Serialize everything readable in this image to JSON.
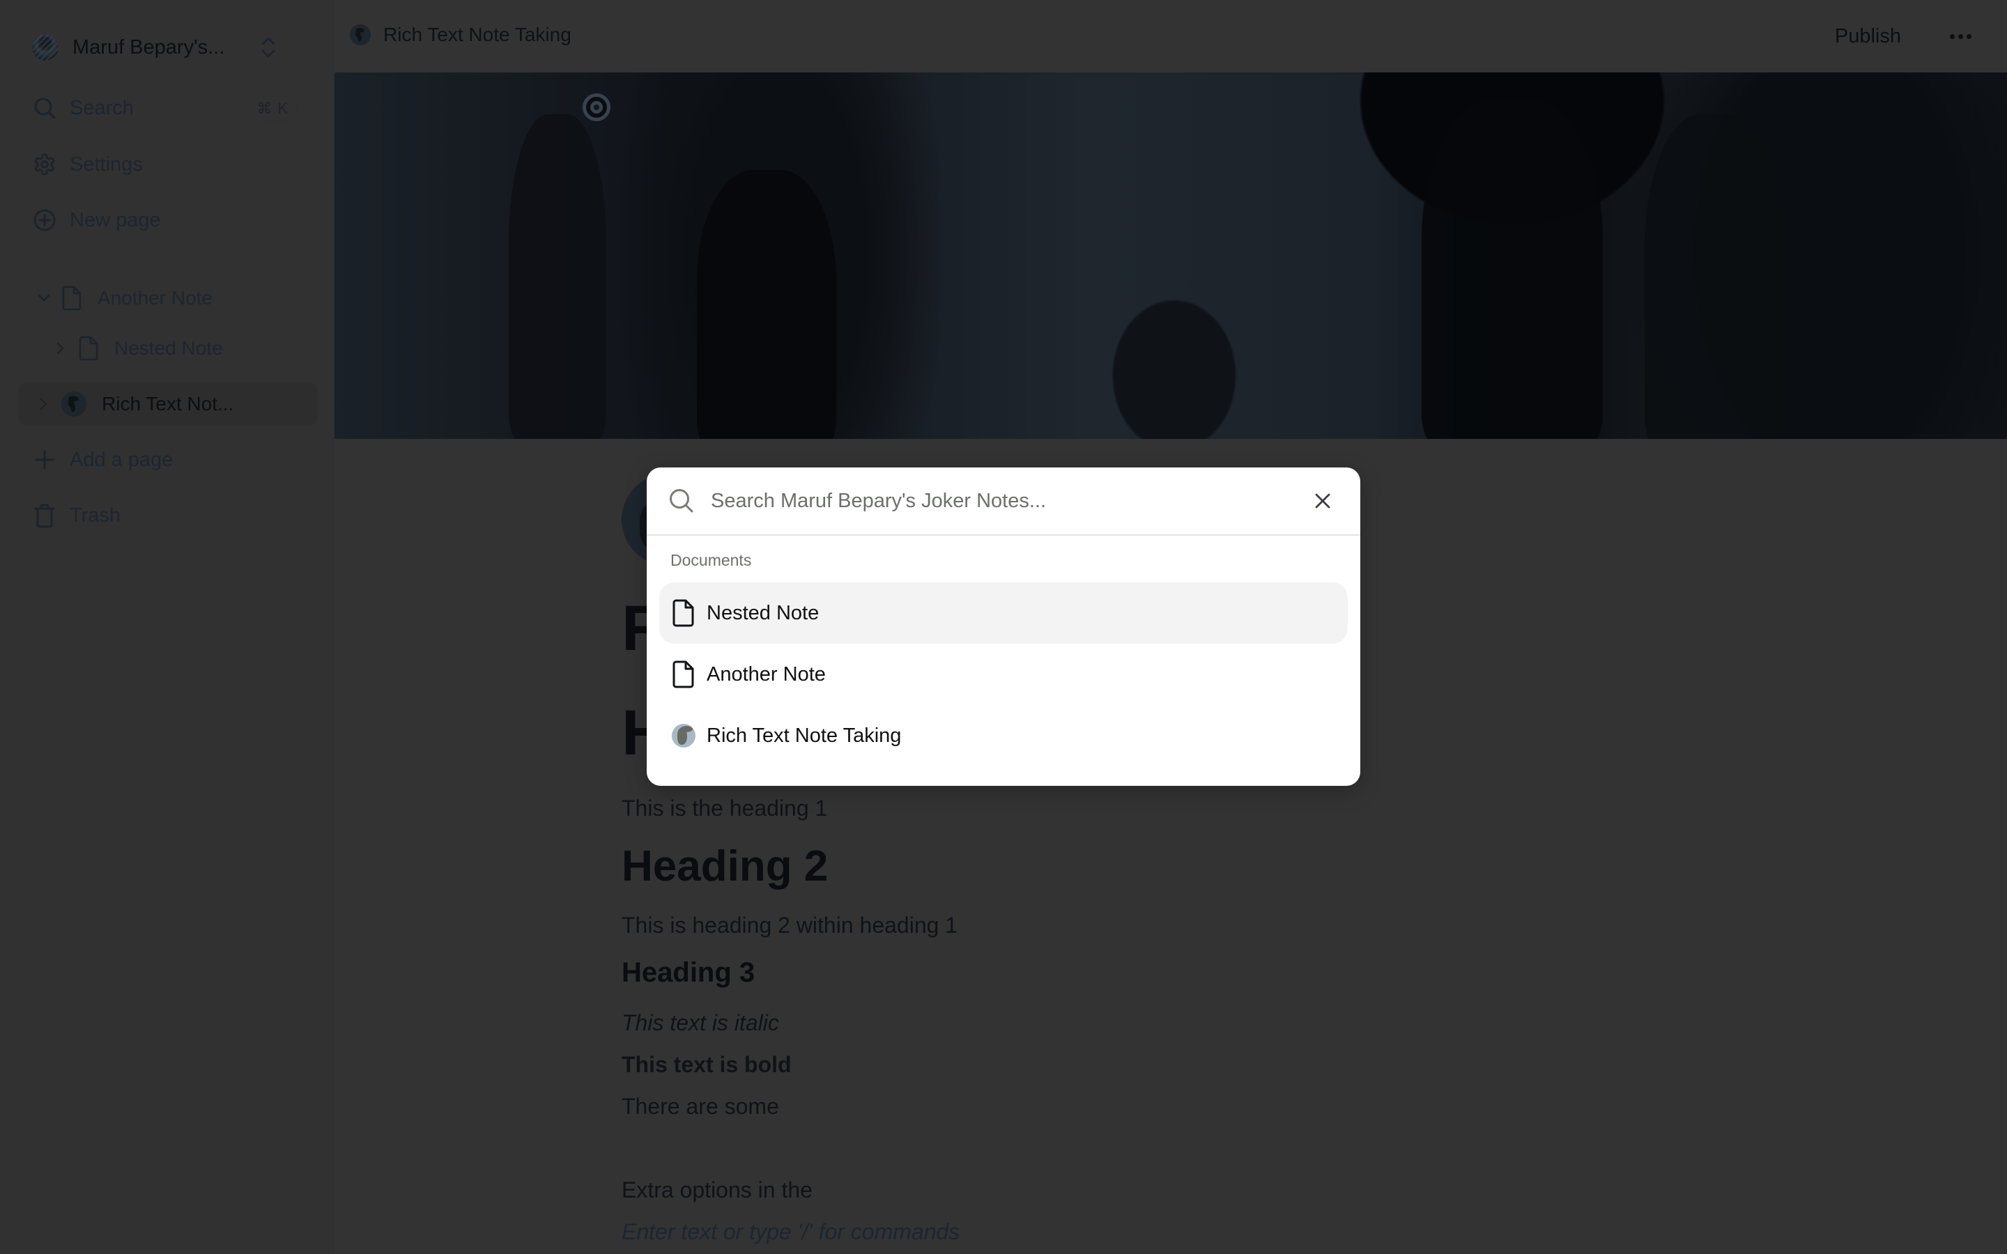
{
  "sidebar": {
    "workspace_name": "Maruf Bepary's...",
    "nav": [
      {
        "label": "Search",
        "icon": "search-icon",
        "shortcut": [
          "⌘",
          "K"
        ]
      },
      {
        "label": "Settings",
        "icon": "gear-icon"
      },
      {
        "label": "New page",
        "icon": "plus-circle-icon"
      }
    ],
    "tree": [
      {
        "label": "Another Note",
        "icon": "file-icon",
        "expanded": true,
        "depth": 0
      },
      {
        "label": "Nested Note",
        "icon": "file-icon",
        "expanded": false,
        "depth": 1
      },
      {
        "label": "Rich Text Not...",
        "icon": "globe-icon",
        "expanded": false,
        "depth": 0,
        "active": true
      }
    ],
    "footer": [
      {
        "label": "Add a page",
        "icon": "plus-icon"
      },
      {
        "label": "Trash",
        "icon": "trash-icon"
      }
    ]
  },
  "header": {
    "breadcrumb": "Rich Text Note Taking",
    "publish_label": "Publish",
    "more_label": "More options"
  },
  "document": {
    "title_partial": "R",
    "h1_partial": "H",
    "blocks": [
      {
        "type": "paragraph",
        "text": "This is the heading 1"
      },
      {
        "type": "heading2",
        "text": "Heading 2"
      },
      {
        "type": "paragraph",
        "text": "This is heading 2 within heading 1"
      },
      {
        "type": "heading3",
        "text": "Heading 3"
      },
      {
        "type": "italic",
        "text": "This text is italic"
      },
      {
        "type": "bold",
        "text": "This text is bold"
      },
      {
        "type": "paragraph",
        "text": "There are some"
      },
      {
        "type": "paragraph",
        "text": "Extra options in the"
      },
      {
        "type": "placeholder",
        "text": "Enter text or type '/' for commands"
      }
    ]
  },
  "search_modal": {
    "placeholder": "Search Maruf Bepary's Joker Notes...",
    "value": "",
    "section_label": "Documents",
    "results": [
      {
        "label": "Nested Note",
        "icon": "file-icon",
        "selected": true
      },
      {
        "label": "Another Note",
        "icon": "file-icon",
        "selected": false
      },
      {
        "label": "Rich Text Note Taking",
        "icon": "globe-icon",
        "selected": false
      }
    ]
  },
  "colors": {
    "overlay_bg": "#333333",
    "modal_bg": "#ffffff",
    "selected_row": "#f3f3f3",
    "muted_text": "#6d706c"
  }
}
